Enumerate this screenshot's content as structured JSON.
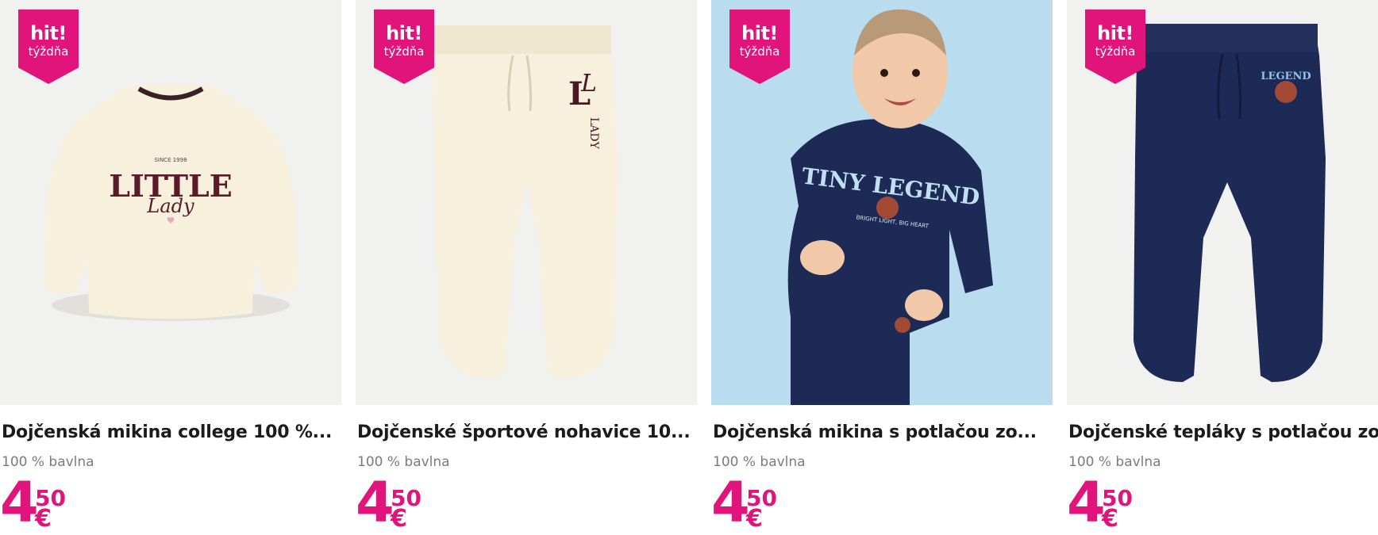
{
  "products": [
    {
      "badge": {
        "line1": "hit!",
        "line2": "týždňa"
      },
      "title": "Dojčenská mikina college 100 %...",
      "subtitle": "100 % bavlna",
      "price": {
        "int": "4",
        "dec": "50",
        "currency": "€"
      },
      "print": {
        "small": "SINCE 1998",
        "main": "LITTLE",
        "script": "Lady"
      },
      "image_icon": "sweatshirt-icon"
    },
    {
      "badge": {
        "line1": "hit!",
        "line2": "týždňa"
      },
      "title": "Dojčenské športové nohavice 10...",
      "subtitle": "100 % bavlna",
      "price": {
        "int": "4",
        "dec": "50",
        "currency": "€"
      },
      "print": {
        "main": "L",
        "script": "L",
        "vertical": "LADY"
      },
      "image_icon": "pants-icon"
    },
    {
      "badge": {
        "line1": "hit!",
        "line2": "týždňa"
      },
      "title": "Dojčenská mikina s potlačou zo...",
      "subtitle": "100 % bavlna",
      "price": {
        "int": "4",
        "dec": "50",
        "currency": "€"
      },
      "print": {
        "main": "TINY LEGEND",
        "small": "BRIGHT LIGHT, BIG HEART"
      },
      "image_icon": "baby-model-icon"
    },
    {
      "badge": {
        "line1": "hit!",
        "line2": "týždňa"
      },
      "title": "Dojčenské tepláky s potlačou zo...",
      "subtitle": "100 % bavlna",
      "price": {
        "int": "4",
        "dec": "50",
        "currency": "€"
      },
      "print": {
        "main": "LEGEND"
      },
      "image_icon": "pants-icon"
    }
  ],
  "colors": {
    "accent": "#e0147a",
    "cream": "#f6f0dd",
    "navy": "#1d2a55",
    "sky": "#b9dcee"
  }
}
